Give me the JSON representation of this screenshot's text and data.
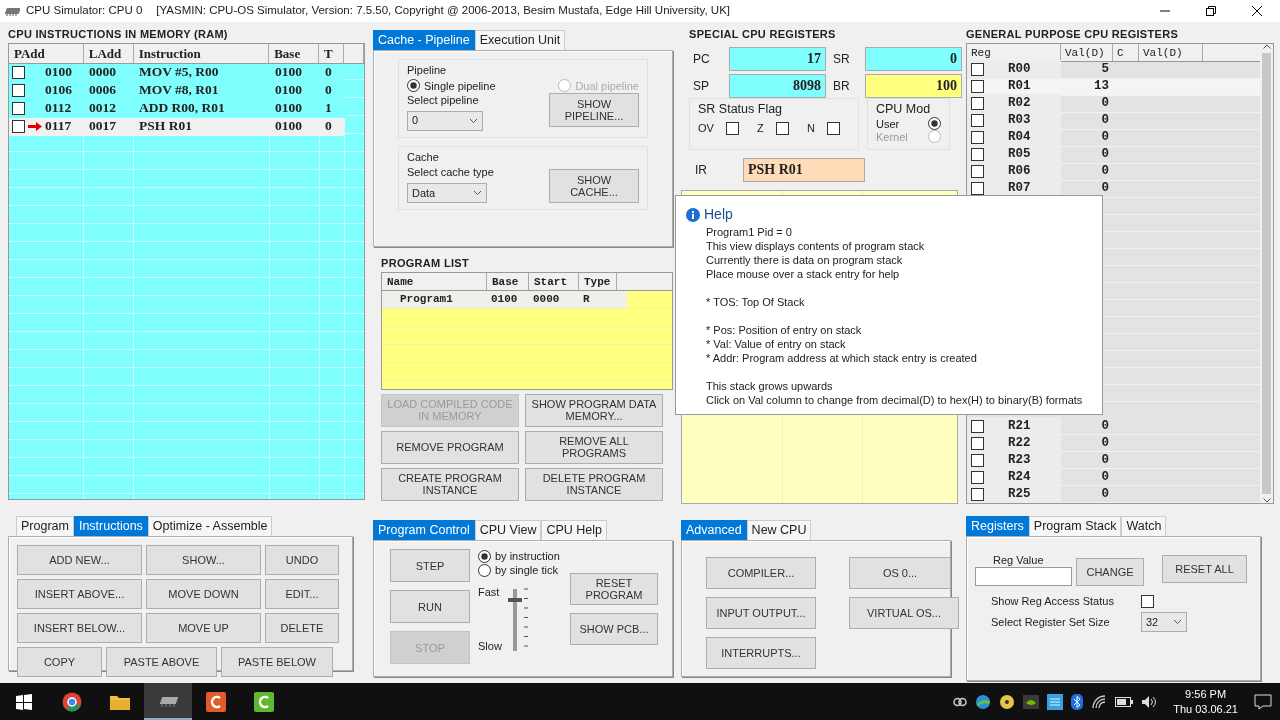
{
  "window": {
    "title": "CPU Simulator: CPU 0",
    "subtitle": "[YASMIN: CPU-OS Simulator,  Version: 7.5.50,  Copyright @ 2006-2013, Besim Mustafa, Edge Hill University, UK]"
  },
  "ram": {
    "title": "CPU INSTRUCTIONS IN MEMORY (RAM)",
    "columns": [
      "PAdd",
      "LAdd",
      "Instruction",
      "Base",
      "T"
    ],
    "rows": [
      {
        "padd": "0100",
        "ladd": "0000",
        "instruction": "MOV #5, R00",
        "base": "0100",
        "t": "0",
        "checked": false,
        "current": false
      },
      {
        "padd": "0106",
        "ladd": "0006",
        "instruction": "MOV #8, R01",
        "base": "0100",
        "t": "0",
        "checked": false,
        "current": false
      },
      {
        "padd": "0112",
        "ladd": "0012",
        "instruction": "ADD R00, R01",
        "base": "0100",
        "t": "1",
        "checked": false,
        "current": false
      },
      {
        "padd": "0117",
        "ladd": "0017",
        "instruction": "PSH R01",
        "base": "0100",
        "t": "0",
        "checked": false,
        "current": true
      }
    ]
  },
  "pipeline_tabs": [
    {
      "label": "Cache - Pipeline",
      "selected": true
    },
    {
      "label": "Execution Unit",
      "selected": false
    }
  ],
  "pipeline": {
    "group": "Pipeline",
    "options": [
      {
        "label": "Single pipeline",
        "selected": true,
        "disabled": false
      },
      {
        "label": "Dual pipeline",
        "selected": false,
        "disabled": true
      }
    ],
    "select_label": "Select pipeline",
    "select_value": "0",
    "button": "SHOW PIPELINE..."
  },
  "cache": {
    "group": "Cache",
    "select_label": "Select cache type",
    "select_value": "Data",
    "button": "SHOW CACHE..."
  },
  "program_list": {
    "title": "PROGRAM LIST",
    "columns": [
      "Name",
      "Base",
      "Start",
      "Type"
    ],
    "rows": [
      [
        "Program1",
        "0100",
        "0000",
        "R"
      ]
    ],
    "buttons": [
      {
        "label": "LOAD COMPILED CODE IN MEMORY",
        "disabled": true
      },
      {
        "label": "SHOW PROGRAM  DATA MEMORY...",
        "disabled": false
      },
      {
        "label": "REMOVE PROGRAM",
        "disabled": false
      },
      {
        "label": "REMOVE ALL PROGRAMS",
        "disabled": false
      },
      {
        "label": "CREATE PROGRAM INSTANCE",
        "disabled": false
      },
      {
        "label": "DELETE PROGRAM INSTANCE",
        "disabled": false
      }
    ]
  },
  "special_registers": {
    "title": "SPECIAL CPU REGISTERS",
    "registers": [
      {
        "name": "PC",
        "value": "17",
        "color": "#80ffff"
      },
      {
        "name": "SR",
        "value": "0",
        "color": "#80ffff"
      },
      {
        "name": "SP",
        "value": "8098",
        "color": "#80ffff"
      },
      {
        "name": "BR",
        "value": "100",
        "color": "#ffff80"
      }
    ],
    "flags_title": "SR Status Flag",
    "flags": [
      {
        "label": "OV",
        "checked": false
      },
      {
        "label": "Z",
        "checked": false
      },
      {
        "label": "N",
        "checked": false
      }
    ],
    "mode_title": "CPU Mod",
    "modes": [
      {
        "label": "User",
        "selected": true,
        "disabled": false
      },
      {
        "label": "Kernel",
        "selected": false,
        "disabled": true
      }
    ],
    "ir_label": "IR",
    "ir_value": "PSH R01"
  },
  "help": {
    "title": "Help",
    "paragraphs": [
      [
        "Program1 Pid = 0",
        "This view displays contents of program stack",
        "Currently there is data on program stack",
        "Place mouse over a stack entry for help"
      ],
      [
        "* TOS: Top Of Stack"
      ],
      [
        "* Pos: Position of entry on stack",
        "* Val: Value of entry on stack",
        "* Addr: Program address at which stack entry is created"
      ],
      [
        "This stack grows upwards",
        "Click on Val column to change from decimal(D) to hex(H) to binary(B) formats"
      ]
    ]
  },
  "general_registers": {
    "title": "GENERAL PURPOSE CPU REGISTERS",
    "columns": [
      "Reg",
      "Val(D)",
      "C",
      "Val(D)"
    ],
    "groups": [
      [
        {
          "name": "R00",
          "value": "5",
          "checked": false,
          "selected": false
        },
        {
          "name": "R01",
          "value": "13",
          "checked": false,
          "selected": true
        },
        {
          "name": "R02",
          "value": "0",
          "checked": false,
          "selected": false
        },
        {
          "name": "R03",
          "value": "0",
          "checked": false,
          "selected": false
        },
        {
          "name": "R04",
          "value": "0",
          "checked": false,
          "selected": false
        },
        {
          "name": "R05",
          "value": "0",
          "checked": false,
          "selected": false
        },
        {
          "name": "R06",
          "value": "0",
          "checked": false,
          "selected": false
        },
        {
          "name": "R07",
          "value": "0",
          "checked": false,
          "selected": false
        }
      ],
      [
        {
          "name": "R21",
          "value": "0",
          "checked": false,
          "selected": false
        },
        {
          "name": "R22",
          "value": "0",
          "checked": false,
          "selected": false
        },
        {
          "name": "R23",
          "value": "0",
          "checked": false,
          "selected": false
        },
        {
          "name": "R24",
          "value": "0",
          "checked": false,
          "selected": false
        },
        {
          "name": "R25",
          "value": "0",
          "checked": false,
          "selected": false
        }
      ]
    ]
  },
  "instruction_tabs": [
    {
      "label": "Program",
      "selected": false
    },
    {
      "label": "Instructions",
      "selected": true
    },
    {
      "label": "Optimize - Assemble",
      "selected": false
    }
  ],
  "instruction_buttons": [
    [
      "ADD NEW...",
      "SHOW...",
      "UNDO"
    ],
    [
      "INSERT ABOVE...",
      "MOVE DOWN",
      "EDIT..."
    ],
    [
      "INSERT BELOW...",
      "MOVE UP",
      "DELETE"
    ],
    [
      "COPY",
      "PASTE ABOVE",
      "PASTE BELOW"
    ]
  ],
  "control_tabs": [
    {
      "label": "Program Control",
      "selected": true
    },
    {
      "label": "CPU View",
      "selected": false
    },
    {
      "label": "CPU Help",
      "selected": false
    }
  ],
  "program_control": {
    "buttons": [
      {
        "label": "STEP",
        "disabled": false
      },
      {
        "label": "RUN",
        "disabled": false
      },
      {
        "label": "STOP",
        "disabled": true
      }
    ],
    "step_modes": [
      {
        "label": "by instruction",
        "selected": true
      },
      {
        "label": "by single tick",
        "selected": false
      }
    ],
    "speed": {
      "fast": "Fast",
      "slow": "Slow",
      "level": 0.85
    },
    "side_buttons": [
      "RESET PROGRAM",
      "SHOW PCB..."
    ]
  },
  "advanced_tabs": [
    {
      "label": "Advanced",
      "selected": true
    },
    {
      "label": "New CPU",
      "selected": false
    }
  ],
  "advanced_buttons": [
    "COMPILER...",
    "OS 0...",
    "INPUT OUTPUT...",
    "VIRTUAL OS...",
    "INTERRUPTS..."
  ],
  "register_tabs": [
    {
      "label": "Registers",
      "selected": true
    },
    {
      "label": "Program Stack",
      "selected": false
    },
    {
      "label": "Watch",
      "selected": false
    }
  ],
  "register_panel": {
    "reg_value_label": "Reg Value",
    "change": "CHANGE",
    "reset": "RESET ALL",
    "access_label": "Show Reg Access Status",
    "access_checked": false,
    "size_label": "Select Register Set Size",
    "size_value": "32"
  },
  "taskbar": {
    "time": "9:56 PM",
    "date": "Thu 03.06.21"
  }
}
